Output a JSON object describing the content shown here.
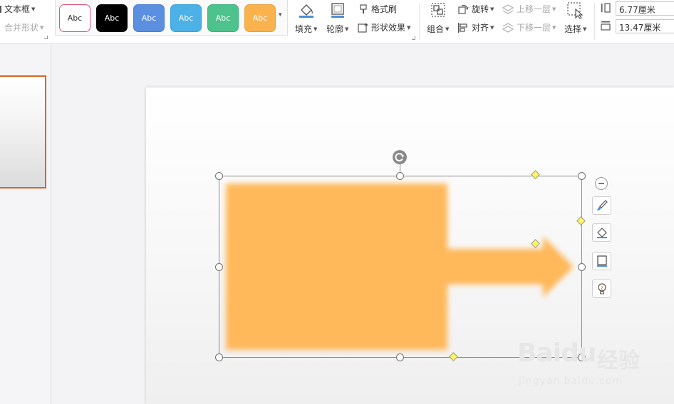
{
  "ribbon": {
    "text_box_label": "文本框",
    "merge_shapes_label": "合并形状",
    "shape_styles": [
      {
        "label": "Abc",
        "bg": "#ffffff",
        "border": "#e0537a",
        "fg": "#333333"
      },
      {
        "label": "Abc",
        "bg": "#000000",
        "border": "#000000",
        "fg": "#ffffff"
      },
      {
        "label": "Abc",
        "bg": "#5b8fe0",
        "border": "#4a7cd0",
        "fg": "#ffffff"
      },
      {
        "label": "Abc",
        "bg": "#4cb1e6",
        "border": "#3aa0d8",
        "fg": "#ffffff"
      },
      {
        "label": "Abc",
        "bg": "#4dc28c",
        "border": "#3db07c",
        "fg": "#ffffff"
      },
      {
        "label": "Abc",
        "bg": "#f9b24c",
        "border": "#e8a03c",
        "fg": "#ffffff"
      }
    ],
    "fill_label": "填充",
    "outline_label": "轮廓",
    "format_painter_label": "格式刷",
    "shape_effects_label": "形状效果",
    "group_label": "组合",
    "rotate_label": "旋转",
    "align_label": "对齐",
    "bring_forward_label": "上移一层",
    "send_backward_label": "下移一层",
    "select_label": "选择",
    "shape_height": "6.77厘米",
    "shape_width": "13.47厘米"
  },
  "canvas": {
    "shape_fill_color": "#ffb85a",
    "thumbnail_border_color": "#d9651f"
  },
  "watermark": {
    "brand": "Baidu",
    "brand_cn": "经验",
    "url": "jingyan.baidu.com"
  }
}
